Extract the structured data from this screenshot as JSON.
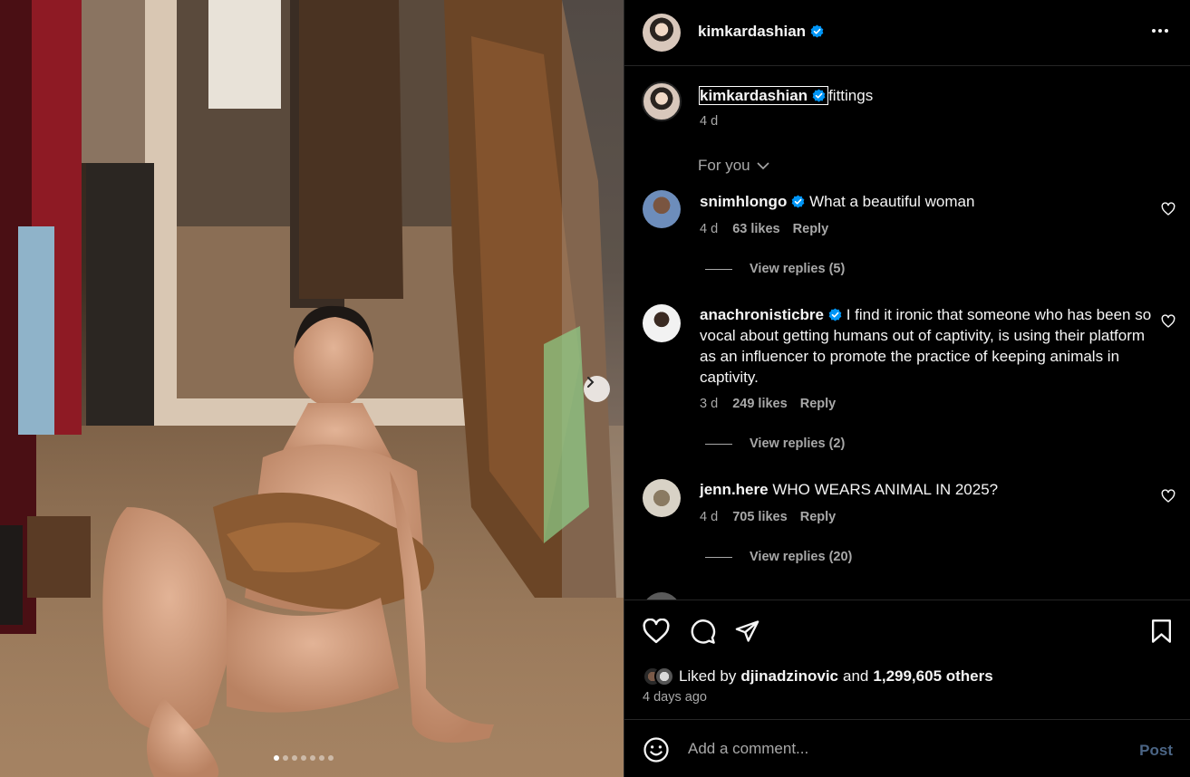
{
  "post": {
    "author": "kimkardashian",
    "caption_text": "fittings",
    "caption_age": "4 d",
    "sort_label": "For you"
  },
  "comments": [
    {
      "user": "snimhlongo",
      "verified": true,
      "text": "What a beautiful woman",
      "age": "4 d",
      "likes": "63 likes",
      "reply_label": "Reply",
      "view_replies": "View replies (5)"
    },
    {
      "user": "anachronisticbre",
      "verified": true,
      "text": "I find it ironic that someone who has been so vocal about getting humans out of captivity, is using their platform as an influencer to promote the practice of keeping animals in captivity.",
      "age": "3 d",
      "likes": "249 likes",
      "reply_label": "Reply",
      "view_replies": "View replies (2)"
    },
    {
      "user": "jenn.here",
      "verified": false,
      "text": "WHO WEARS ANIMAL IN 2025?",
      "age": "4 d",
      "likes": "705 likes",
      "reply_label": "Reply",
      "view_replies": "View replies (20)"
    }
  ],
  "likes": {
    "prefix": "Liked by",
    "user": "djinadzinovic",
    "joiner": "and",
    "others": "1,299,605 others",
    "time_ago": "4 days ago"
  },
  "composer": {
    "placeholder": "Add a comment...",
    "post_label": "Post"
  },
  "carousel": {
    "total_slides": 7,
    "active_slide": 1
  },
  "colors": {
    "verified_badge": "#0095f6",
    "post_disabled": "#4b6585",
    "secondary_text": "#a8a8a8",
    "divider": "#262626"
  },
  "icons": [
    "verified-badge-icon",
    "more-options-icon",
    "heart-icon",
    "comment-icon",
    "share-icon",
    "bookmark-icon",
    "emoji-icon",
    "chevron-right-icon",
    "chevron-down-icon"
  ]
}
